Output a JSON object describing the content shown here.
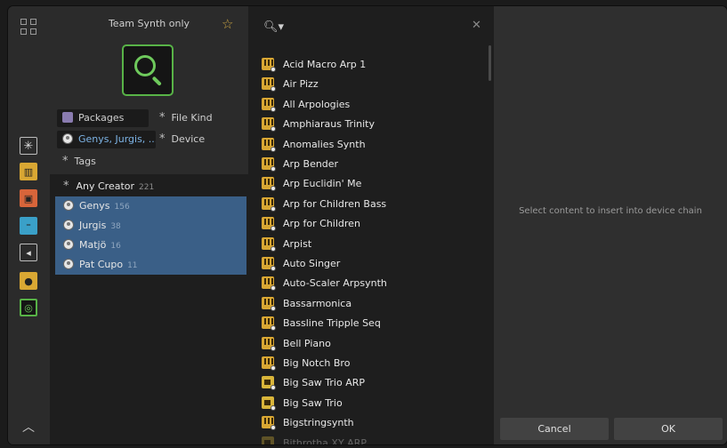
{
  "filters": {
    "header": "Team Synth only",
    "packages_label": "Packages",
    "file_kind_label": "File Kind",
    "creators_label": "Genys, Jurgis, ...",
    "device_label": "Device",
    "tags_label": "Tags"
  },
  "creators": [
    {
      "name": "Any Creator",
      "count": "221"
    },
    {
      "name": "Genys",
      "count": "156"
    },
    {
      "name": "Jurgis",
      "count": "38"
    },
    {
      "name": "Matjö",
      "count": "16"
    },
    {
      "name": "Pat Cupo",
      "count": "11"
    }
  ],
  "results": {
    "items": [
      {
        "label": "Acid Macro Arp 1",
        "icon": "keyboard-icon"
      },
      {
        "label": "Air Pizz",
        "icon": "keyboard-icon"
      },
      {
        "label": "All Arpologies",
        "icon": "keyboard-icon"
      },
      {
        "label": "Amphiaraus Trinity",
        "icon": "keyboard-icon"
      },
      {
        "label": "Anomalies Synth",
        "icon": "keyboard-icon"
      },
      {
        "label": "Arp Bender",
        "icon": "keyboard-icon"
      },
      {
        "label": "Arp Euclidin' Me",
        "icon": "keyboard-icon"
      },
      {
        "label": "Arp for Children Bass",
        "icon": "keyboard-icon"
      },
      {
        "label": "Arp for Children",
        "icon": "keyboard-icon"
      },
      {
        "label": "Arpist",
        "icon": "keyboard-icon"
      },
      {
        "label": "Auto Singer",
        "icon": "keyboard-icon"
      },
      {
        "label": "Auto-Scaler Arpsynth",
        "icon": "keyboard-icon"
      },
      {
        "label": "Bassarmonica",
        "icon": "keyboard-icon"
      },
      {
        "label": "Bassline Tripple Seq",
        "icon": "keyboard-icon"
      },
      {
        "label": "Bell Piano",
        "icon": "keyboard-icon"
      },
      {
        "label": "Big Notch Bro",
        "icon": "keyboard-icon"
      },
      {
        "label": "Big Saw Trio ARP",
        "icon": "note-effect-icon"
      },
      {
        "label": "Big Saw Trio",
        "icon": "note-effect-icon"
      },
      {
        "label": "Bigstringsynth",
        "icon": "keyboard-icon"
      },
      {
        "label": "Bithrotha XY ARP",
        "icon": "note-effect-icon"
      }
    ]
  },
  "detail": {
    "hint": "Select content to insert into device chain",
    "cancel_label": "Cancel",
    "ok_label": "OK"
  },
  "colors": {
    "accent_green": "#58b347",
    "selection_blue": "#3a5f87",
    "instrument_yellow": "#d9a733"
  }
}
